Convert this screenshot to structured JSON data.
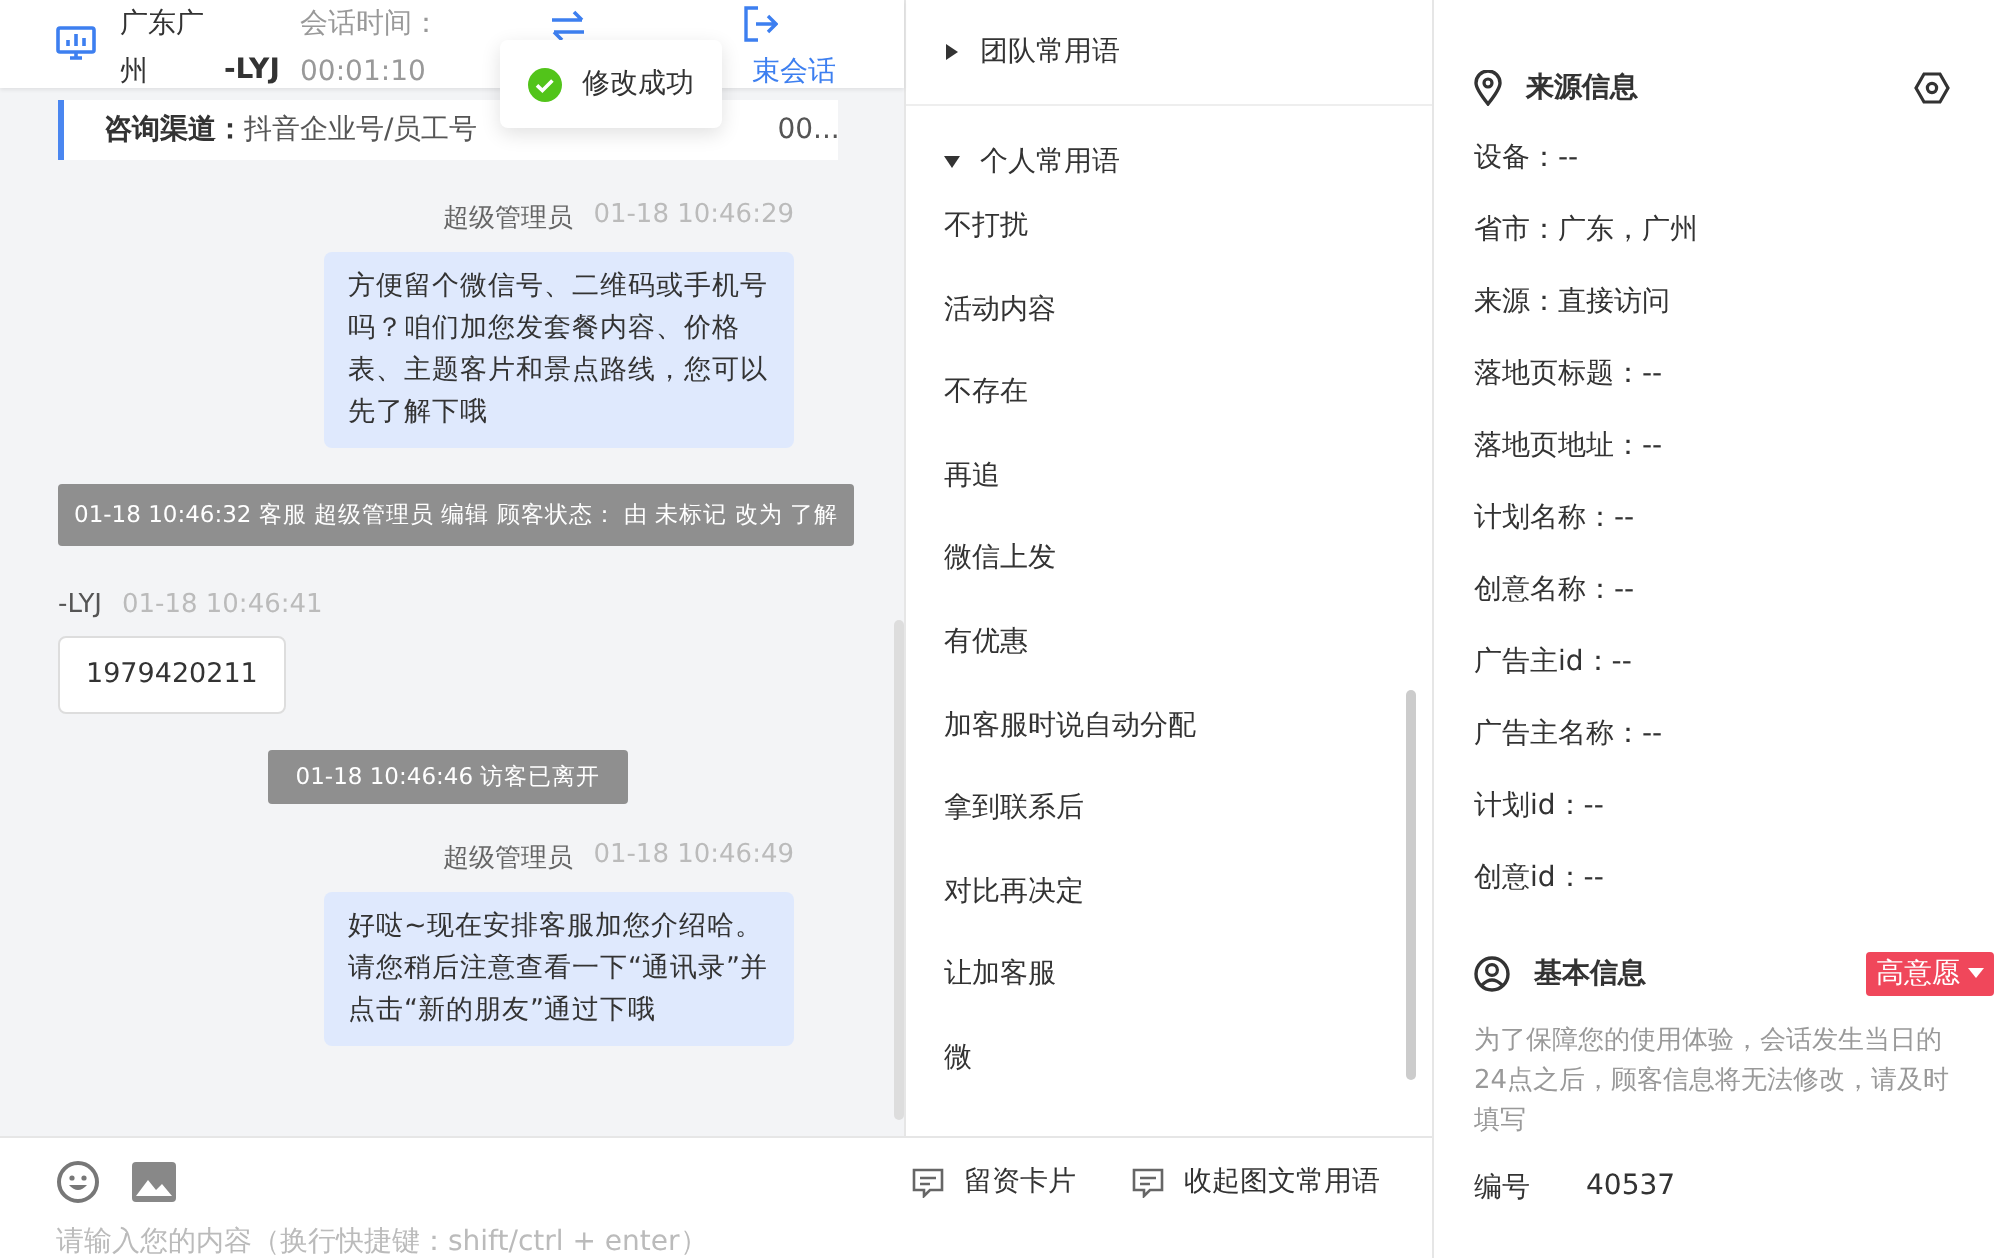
{
  "header": {
    "location": "广东广州",
    "visitor": "-LYJ",
    "session_label": "会话时间：",
    "session_time": "00:01:10",
    "end_label": "束会话"
  },
  "toast": {
    "text": "修改成功"
  },
  "channel": {
    "label": "咨询渠道：",
    "value": "抖音企业号/员工号",
    "tail": "00..."
  },
  "messages": [
    {
      "kind": "agent",
      "name": "超级管理员",
      "time": "01-18 10:46:29",
      "text": "方便留个微信号、二维码或手机号吗？咱们加您发套餐内容、价格表、主题客片和景点路线，您可以先了解下哦"
    },
    {
      "kind": "system",
      "text": "01-18 10:46:32 客服 超级管理员 编辑 顾客状态： 由 未标记 改为 了解"
    },
    {
      "kind": "visitor",
      "name": "-LYJ",
      "time": "01-18 10:46:41",
      "text": "1979420211"
    },
    {
      "kind": "system",
      "text": "01-18 10:46:46 访客已离开"
    },
    {
      "kind": "agent",
      "name": "超级管理员",
      "time": "01-18 10:46:49",
      "text": "好哒~现在安排客服加您介绍哈。请您稍后注意查看一下“通讯录”并点击“新的朋友”通过下哦"
    }
  ],
  "composer": {
    "placeholder": "请输入您的内容（换行快捷键：shift/ctrl + enter）",
    "actions": [
      "留资卡片",
      "收起图文常用语"
    ]
  },
  "phrases": {
    "groups": [
      {
        "title": "团队常用语",
        "expanded": false
      },
      {
        "title": "个人常用语",
        "expanded": true,
        "items": [
          "不打扰",
          "活动内容",
          "不存在",
          "再追",
          "微信上发",
          "有优惠",
          "加客服时说自动分配",
          "拿到联系后",
          "对比再决定",
          "让加客服",
          "微"
        ]
      }
    ]
  },
  "source_info": {
    "title": "来源信息",
    "rows": [
      "设备：--",
      "省市：广东，广州",
      "来源：直接访问",
      "落地页标题：--",
      "落地页地址：--",
      "计划名称：--",
      "创意名称：--",
      "广告主id：--",
      "广告主名称：--",
      "计划id：--",
      "创意id：--"
    ]
  },
  "basic_info": {
    "title": "基本信息",
    "intent": "高意愿",
    "note": "为了保障您的使用体验，会话发生当日的24点之后，顾客信息将无法修改，请及时填写",
    "fields": [
      {
        "label": "编号",
        "value": "40537"
      }
    ]
  }
}
